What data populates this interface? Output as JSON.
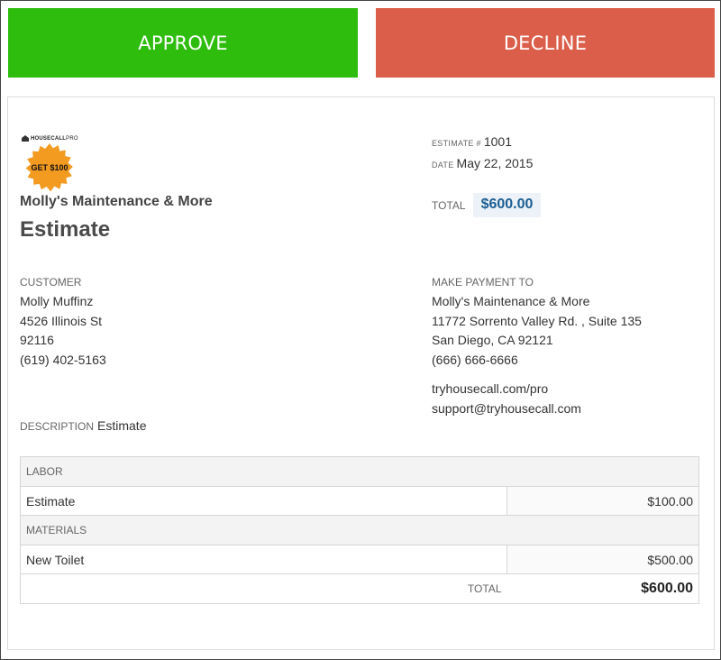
{
  "actions": {
    "approve": "APPROVE",
    "decline": "DECLINE"
  },
  "colors": {
    "approve": "#2ebd0d",
    "decline": "#db5e4a",
    "total_accent": "#1b5d92",
    "badge": "#f39a21"
  },
  "logo": {
    "brand_main": "HOUSECALL",
    "brand_pro": "PRO",
    "badge_text": "GET $100"
  },
  "header": {
    "company": "Molly's Maintenance & More",
    "title": "Estimate",
    "estimate_label": "ESTIMATE #",
    "estimate_number": "1001",
    "date_label": "DATE",
    "date_value": "May 22, 2015",
    "total_label": "TOTAL",
    "total_value": "$600.00"
  },
  "customer": {
    "label": "CUSTOMER",
    "name": "Molly Muffinz",
    "street": "4526 Illinois St",
    "zip": "92116",
    "phone": "(619) 402-5163"
  },
  "payment": {
    "label": "MAKE PAYMENT TO",
    "name": "Molly's Maintenance & More",
    "street": "11772 Sorrento Valley Rd. , Suite 135",
    "city": "San Diego, CA 92121",
    "phone": "(666) 666-6666",
    "website": "tryhousecall.com/pro",
    "email": "support@tryhousecall.com"
  },
  "description": {
    "label": "DESCRIPTION",
    "value": "Estimate"
  },
  "line_items": {
    "labor_header": "LABOR",
    "labor": [
      {
        "name": "Estimate",
        "amount": "$100.00"
      }
    ],
    "materials_header": "MATERIALS",
    "materials": [
      {
        "name": "New Toilet",
        "amount": "$500.00"
      }
    ],
    "total_label": "TOTAL",
    "total_value": "$600.00"
  }
}
